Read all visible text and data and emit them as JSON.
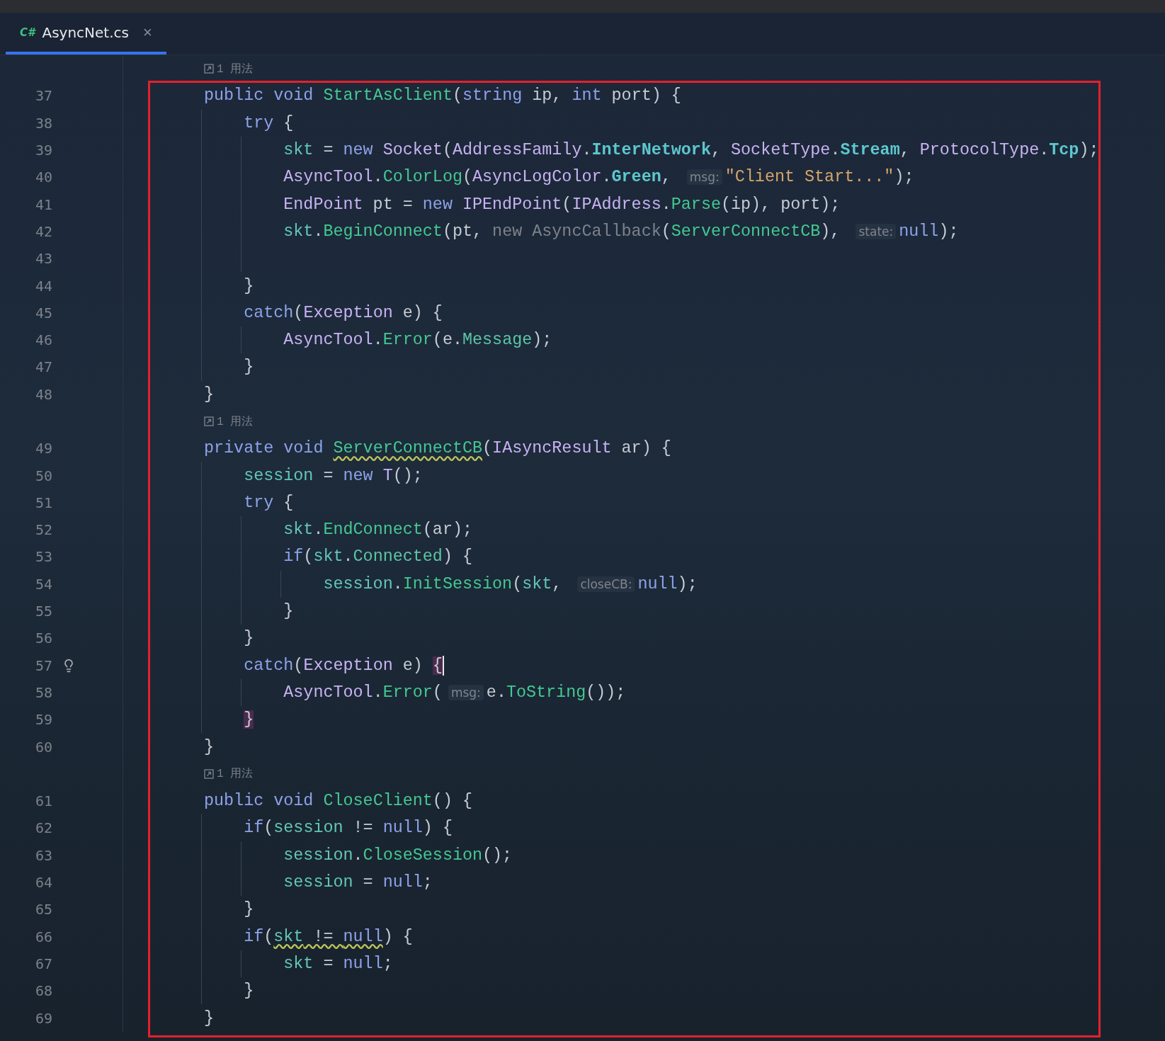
{
  "tab": {
    "icon_label": "C#",
    "title": "AsyncNet.cs",
    "close": "×",
    "selected": true
  },
  "lines": [
    {
      "kind": "usage",
      "text": "1 用法"
    },
    {
      "kind": "code",
      "number": "37",
      "bulb": false,
      "caret": false,
      "tokens": [
        {
          "t": "public void ",
          "kind": "kw"
        },
        {
          "t": "StartAsClient",
          "kind": "fn"
        },
        {
          "t": "(",
          "kind": "p"
        },
        {
          "t": "string ",
          "kind": "kw"
        },
        {
          "t": "ip, ",
          "kind": "p"
        },
        {
          "t": "int ",
          "kind": "kw"
        },
        {
          "t": "port) {",
          "kind": "p"
        }
      ],
      "children": [
        {
          "number": "38",
          "bulb": false,
          "caret": false,
          "tokens": [
            {
              "t": "try ",
              "kind": "kw"
            },
            {
              "t": "{",
              "kind": "p"
            }
          ],
          "children": [
            {
              "number": "39",
              "bulb": false,
              "caret": false,
              "tokens": [
                {
                  "t": "skt",
                  "kind": "var"
                },
                {
                  "t": " = ",
                  "kind": "p"
                },
                {
                  "t": "new ",
                  "kind": "kw"
                },
                {
                  "t": "Socket",
                  "kind": "type"
                },
                {
                  "t": "(",
                  "kind": "p"
                },
                {
                  "t": "AddressFamily",
                  "kind": "type"
                },
                {
                  "t": ".",
                  "kind": "p"
                },
                {
                  "t": "InterNetwork",
                  "kind": "enum"
                },
                {
                  "t": ", ",
                  "kind": "p"
                },
                {
                  "t": "SocketType",
                  "kind": "type"
                },
                {
                  "t": ".",
                  "kind": "p"
                },
                {
                  "t": "Stream",
                  "kind": "enum"
                },
                {
                  "t": ", ",
                  "kind": "p"
                },
                {
                  "t": "ProtocolType",
                  "kind": "type"
                },
                {
                  "t": ".",
                  "kind": "p"
                },
                {
                  "t": "Tcp",
                  "kind": "enum"
                },
                {
                  "t": ");",
                  "kind": "p"
                }
              ]
            },
            {
              "number": "40",
              "bulb": false,
              "caret": false,
              "tokens": [
                {
                  "t": "AsyncTool",
                  "kind": "type"
                },
                {
                  "t": ".",
                  "kind": "p"
                },
                {
                  "t": "ColorLog",
                  "kind": "fn"
                },
                {
                  "t": "(",
                  "kind": "p"
                },
                {
                  "t": "AsyncLogColor",
                  "kind": "type"
                },
                {
                  "t": ".",
                  "kind": "p"
                },
                {
                  "t": "Green",
                  "kind": "enum"
                },
                {
                  "t": ", ",
                  "kind": "p"
                },
                {
                  "t": "msg:",
                  "kind": "hint"
                },
                {
                  "t": "\"Client Start...\"",
                  "kind": "str"
                },
                {
                  "t": ");",
                  "kind": "p"
                }
              ]
            },
            {
              "number": "41",
              "bulb": false,
              "caret": false,
              "tokens": [
                {
                  "t": "EndPoint",
                  "kind": "type"
                },
                {
                  "t": " pt = ",
                  "kind": "p"
                },
                {
                  "t": "new ",
                  "kind": "kw"
                },
                {
                  "t": "IPEndPoint",
                  "kind": "type"
                },
                {
                  "t": "(",
                  "kind": "p"
                },
                {
                  "t": "IPAddress",
                  "kind": "type"
                },
                {
                  "t": ".",
                  "kind": "p"
                },
                {
                  "t": "Parse",
                  "kind": "fn"
                },
                {
                  "t": "(ip), port);",
                  "kind": "p"
                }
              ]
            },
            {
              "number": "42",
              "bulb": false,
              "caret": false,
              "tokens": [
                {
                  "t": "skt",
                  "kind": "var"
                },
                {
                  "t": ".",
                  "kind": "p"
                },
                {
                  "t": "BeginConnect",
                  "kind": "fn"
                },
                {
                  "t": "(pt, ",
                  "kind": "p"
                },
                {
                  "t": "new AsyncCallback",
                  "kind": "dim"
                },
                {
                  "t": "(",
                  "kind": "p"
                },
                {
                  "t": "ServerConnectCB",
                  "kind": "fn"
                },
                {
                  "t": "), ",
                  "kind": "p"
                },
                {
                  "t": "state:",
                  "kind": "hint"
                },
                {
                  "t": "null",
                  "kind": "kw"
                },
                {
                  "t": ");",
                  "kind": "p"
                }
              ]
            },
            {
              "number": "43",
              "bulb": false,
              "caret": false
            }
          ]
        },
        {
          "number": "44",
          "bulb": false,
          "caret": false,
          "tokens": [
            {
              "t": "}",
              "kind": "p"
            }
          ]
        },
        {
          "number": "45",
          "bulb": false,
          "caret": false,
          "tokens": [
            {
              "t": "catch",
              "kind": "kw"
            },
            {
              "t": "(",
              "kind": "p"
            },
            {
              "t": "Exception",
              "kind": "type"
            },
            {
              "t": " e) {",
              "kind": "p"
            }
          ],
          "children": [
            {
              "number": "46",
              "bulb": false,
              "caret": false,
              "tokens": [
                {
                  "t": "AsyncTool",
                  "kind": "type"
                },
                {
                  "t": ".",
                  "kind": "p"
                },
                {
                  "t": "Error",
                  "kind": "fn"
                },
                {
                  "t": "(e.",
                  "kind": "p"
                },
                {
                  "t": "Message",
                  "kind": "prop"
                },
                {
                  "t": ");",
                  "kind": "p"
                }
              ]
            }
          ]
        },
        {
          "number": "47",
          "bulb": false,
          "caret": false,
          "tokens": [
            {
              "t": "}",
              "kind": "p"
            }
          ]
        }
      ]
    },
    {
      "kind": "code",
      "number": "48",
      "bulb": false,
      "caret": false,
      "tokens": [
        {
          "t": "}",
          "kind": "p"
        }
      ]
    },
    {
      "kind": "usage",
      "text": "1 用法"
    },
    {
      "kind": "code",
      "number": "49",
      "bulb": false,
      "caret": false,
      "tokens": [
        {
          "t": "private void ",
          "kind": "kw"
        },
        {
          "t": "ServerConnectCB",
          "kind": "fn",
          "warn": true
        },
        {
          "t": "(",
          "kind": "p"
        },
        {
          "t": "IAsyncResult",
          "kind": "type"
        },
        {
          "t": " ar) {",
          "kind": "p"
        }
      ],
      "children": [
        {
          "number": "50",
          "bulb": false,
          "caret": false,
          "tokens": [
            {
              "t": "session",
              "kind": "var"
            },
            {
              "t": " = ",
              "kind": "p"
            },
            {
              "t": "new ",
              "kind": "kw"
            },
            {
              "t": "T",
              "kind": "type"
            },
            {
              "t": "();",
              "kind": "p"
            }
          ]
        },
        {
          "number": "51",
          "bulb": false,
          "caret": false,
          "tokens": [
            {
              "t": "try ",
              "kind": "kw"
            },
            {
              "t": "{",
              "kind": "p"
            }
          ],
          "children": [
            {
              "number": "52",
              "bulb": false,
              "caret": false,
              "tokens": [
                {
                  "t": "skt",
                  "kind": "var"
                },
                {
                  "t": ".",
                  "kind": "p"
                },
                {
                  "t": "EndConnect",
                  "kind": "fn"
                },
                {
                  "t": "(ar);",
                  "kind": "p"
                }
              ]
            },
            {
              "number": "53",
              "bulb": false,
              "caret": false,
              "tokens": [
                {
                  "t": "if",
                  "kind": "kw"
                },
                {
                  "t": "(",
                  "kind": "p"
                },
                {
                  "t": "skt",
                  "kind": "var"
                },
                {
                  "t": ".",
                  "kind": "p"
                },
                {
                  "t": "Connected",
                  "kind": "prop"
                },
                {
                  "t": ") {",
                  "kind": "p"
                }
              ],
              "children": [
                {
                  "number": "54",
                  "bulb": false,
                  "caret": false,
                  "tokens": [
                    {
                      "t": "session",
                      "kind": "var"
                    },
                    {
                      "t": ".",
                      "kind": "p"
                    },
                    {
                      "t": "InitSession",
                      "kind": "fn"
                    },
                    {
                      "t": "(",
                      "kind": "p"
                    },
                    {
                      "t": "skt",
                      "kind": "var"
                    },
                    {
                      "t": ", ",
                      "kind": "p"
                    },
                    {
                      "t": "closeCB:",
                      "kind": "hint"
                    },
                    {
                      "t": "null",
                      "kind": "kw"
                    },
                    {
                      "t": ");",
                      "kind": "p"
                    }
                  ]
                }
              ]
            },
            {
              "number": "55",
              "bulb": false,
              "caret": false,
              "tokens": [
                {
                  "t": "}",
                  "kind": "p"
                }
              ]
            }
          ]
        },
        {
          "number": "56",
          "bulb": false,
          "caret": false,
          "tokens": [
            {
              "t": "}",
              "kind": "p"
            }
          ]
        },
        {
          "number": "57",
          "bulb": true,
          "caret": true,
          "tokens": [
            {
              "t": "catch",
              "kind": "kw"
            },
            {
              "t": "(",
              "kind": "p"
            },
            {
              "t": "Exception",
              "kind": "type"
            },
            {
              "t": " e) ",
              "kind": "p"
            },
            {
              "t": "{",
              "kind": "p",
              "match": true
            }
          ],
          "children": [
            {
              "number": "58",
              "bulb": false,
              "caret": false,
              "tokens": [
                {
                  "t": "AsyncTool",
                  "kind": "type"
                },
                {
                  "t": ".",
                  "kind": "p"
                },
                {
                  "t": "Error",
                  "kind": "fn"
                },
                {
                  "t": "(",
                  "kind": "p"
                },
                {
                  "t": "msg:",
                  "kind": "hint"
                },
                {
                  "t": "e.",
                  "kind": "p"
                },
                {
                  "t": "ToString",
                  "kind": "fn"
                },
                {
                  "t": "());",
                  "kind": "p"
                }
              ]
            }
          ]
        },
        {
          "number": "59",
          "bulb": false,
          "caret": false,
          "tokens": [
            {
              "t": "}",
              "kind": "p",
              "match": true
            }
          ]
        }
      ]
    },
    {
      "kind": "code",
      "number": "60",
      "bulb": false,
      "caret": false,
      "tokens": [
        {
          "t": "}",
          "kind": "p"
        }
      ]
    },
    {
      "kind": "usage",
      "text": "1 用法"
    },
    {
      "kind": "code",
      "number": "61",
      "bulb": false,
      "caret": false,
      "tokens": [
        {
          "t": "public void ",
          "kind": "kw"
        },
        {
          "t": "CloseClient",
          "kind": "fn"
        },
        {
          "t": "() {",
          "kind": "p"
        }
      ],
      "children": [
        {
          "number": "62",
          "bulb": false,
          "caret": false,
          "tokens": [
            {
              "t": "if",
              "kind": "kw"
            },
            {
              "t": "(",
              "kind": "p"
            },
            {
              "t": "session",
              "kind": "var"
            },
            {
              "t": " != ",
              "kind": "p"
            },
            {
              "t": "null",
              "kind": "kw"
            },
            {
              "t": ") {",
              "kind": "p"
            }
          ],
          "children": [
            {
              "number": "63",
              "bulb": false,
              "caret": false,
              "tokens": [
                {
                  "t": "session",
                  "kind": "var"
                },
                {
                  "t": ".",
                  "kind": "p"
                },
                {
                  "t": "CloseSession",
                  "kind": "fn"
                },
                {
                  "t": "();",
                  "kind": "p"
                }
              ]
            },
            {
              "number": "64",
              "bulb": false,
              "caret": false,
              "tokens": [
                {
                  "t": "session",
                  "kind": "var"
                },
                {
                  "t": " = ",
                  "kind": "p"
                },
                {
                  "t": "null",
                  "kind": "kw"
                },
                {
                  "t": ";",
                  "kind": "p"
                }
              ]
            }
          ]
        },
        {
          "number": "65",
          "bulb": false,
          "caret": false,
          "tokens": [
            {
              "t": "}",
              "kind": "p"
            }
          ]
        },
        {
          "number": "66",
          "bulb": false,
          "caret": false,
          "tokens": [
            {
              "t": "if",
              "kind": "kw"
            },
            {
              "t": "(",
              "kind": "p"
            },
            {
              "t": "skt",
              "kind": "var",
              "warn": true
            },
            {
              "t": " != ",
              "kind": "p",
              "warn": true
            },
            {
              "t": "null",
              "kind": "kw",
              "warn": true
            },
            {
              "t": ") {",
              "kind": "p"
            }
          ],
          "children": [
            {
              "number": "67",
              "bulb": false,
              "caret": false,
              "tokens": [
                {
                  "t": "skt",
                  "kind": "var"
                },
                {
                  "t": " = ",
                  "kind": "p"
                },
                {
                  "t": "null",
                  "kind": "kw"
                },
                {
                  "t": ";",
                  "kind": "p"
                }
              ]
            }
          ]
        },
        {
          "number": "68",
          "bulb": false,
          "caret": false,
          "tokens": [
            {
              "t": "}",
              "kind": "p"
            }
          ]
        }
      ]
    },
    {
      "kind": "code",
      "number": "69",
      "bulb": false,
      "caret": false,
      "tokens": [
        {
          "t": "}",
          "kind": "p"
        }
      ]
    }
  ]
}
